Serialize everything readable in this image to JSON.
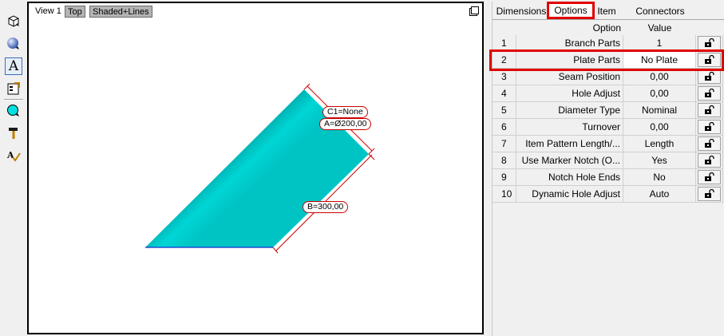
{
  "toolbar": {
    "tools": [
      {
        "icon": "3d-box-icon"
      },
      {
        "icon": "sphere-icon"
      },
      {
        "icon": "text-icon",
        "glyph": "A"
      },
      {
        "icon": "properties-icon"
      },
      {
        "icon": "circle-icon"
      },
      {
        "icon": "hammer-icon"
      },
      {
        "icon": "spell-check-icon"
      }
    ]
  },
  "viewport": {
    "view_label": "View 1",
    "top_button": "Top",
    "shading_button": "Shaded+Lines",
    "shape_color": "#00c2c2",
    "dimensions": {
      "c1": "C1=None",
      "a": "A=Ø200,00",
      "b": "B=300,00"
    }
  },
  "panel": {
    "tabs": [
      {
        "label": "Dimensions"
      },
      {
        "label": "Options",
        "active": true
      },
      {
        "label": "Item"
      },
      {
        "label": "Connectors"
      }
    ],
    "columns": {
      "option": "Option",
      "value": "Value"
    },
    "rows": [
      {
        "num": "1",
        "option": "Branch Parts",
        "value": "1"
      },
      {
        "num": "2",
        "option": "Plate Parts",
        "value": "No Plate",
        "highlighted": true
      },
      {
        "num": "3",
        "option": "Seam Position",
        "value": "0,00"
      },
      {
        "num": "4",
        "option": "Hole Adjust",
        "value": "0,00"
      },
      {
        "num": "5",
        "option": "Diameter Type",
        "value": "Nominal"
      },
      {
        "num": "6",
        "option": "Turnover",
        "value": "0,00"
      },
      {
        "num": "7",
        "option": "Item Pattern Length/...",
        "value": "Length"
      },
      {
        "num": "8",
        "option": "Use Marker Notch (O...",
        "value": "Yes"
      },
      {
        "num": "9",
        "option": "Notch Hole Ends",
        "value": "No"
      },
      {
        "num": "10",
        "option": "Dynamic Hole Adjust",
        "value": "Auto"
      }
    ],
    "highlight_color": "#e00000"
  }
}
